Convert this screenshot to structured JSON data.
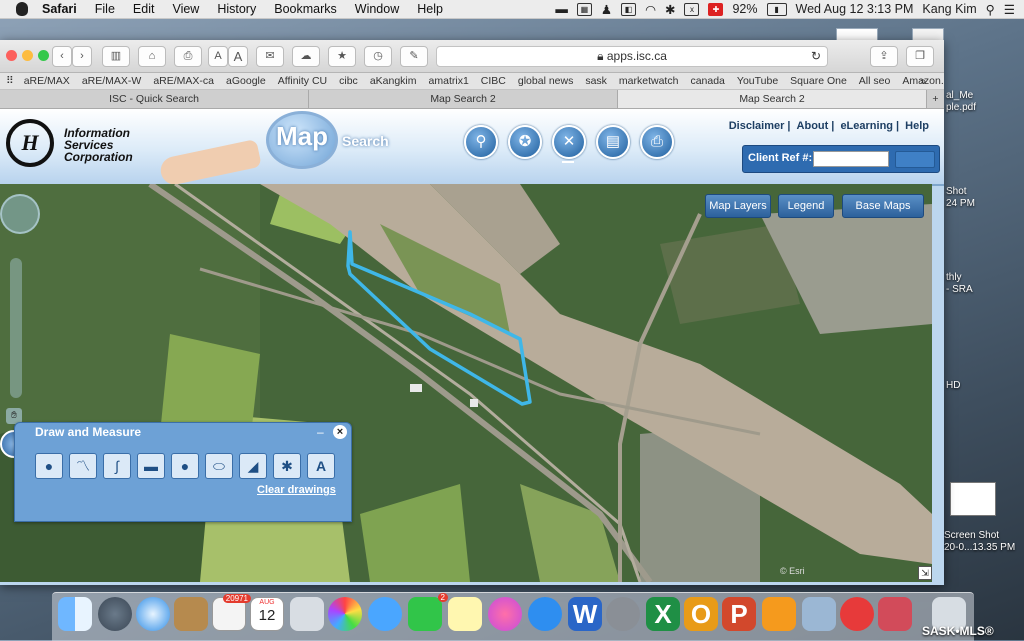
{
  "menubar": {
    "app": "Safari",
    "items": [
      "File",
      "Edit",
      "View",
      "History",
      "Bookmarks",
      "Window",
      "Help"
    ],
    "battery": "92%",
    "datetime": "Wed Aug 12  3:13 PM",
    "user": "Kang Kim"
  },
  "browser": {
    "url": "apps.isc.ca",
    "favorites": [
      "aRE/MAX",
      "aRE/MAX-W",
      "aRE/MAX-ca",
      "aGoogle",
      "Affinity CU",
      "cibc",
      "aKangkim",
      "amatrix1",
      "CIBC",
      "global news",
      "sask",
      "marketwatch",
      "canada",
      "YouTube",
      "Square One",
      "All seo",
      "Amazon.ca"
    ],
    "tabs": [
      "ISC - Quick Search",
      "Map Search 2",
      "Map Search 2"
    ],
    "text_size_small": "A",
    "text_size_large": "A"
  },
  "header": {
    "logo_lines": [
      "Information",
      "Services",
      "Corporation"
    ],
    "map_word": "Map",
    "search_word": "Search",
    "links": [
      "Disclaimer",
      "About",
      "eLearning",
      "Help"
    ],
    "client_ref_label": "Client Ref #:"
  },
  "map": {
    "buttons": [
      "Map Layers",
      "Legend",
      "Base Maps"
    ],
    "attribution": "© Esri"
  },
  "draw_panel": {
    "title": "Draw and Measure",
    "clear_label": "Clear drawings"
  },
  "desktop": {
    "items": [
      "al_Me",
      "ple.pdf",
      "Shot",
      "24 PM",
      "thly",
      "- SRA",
      "HD",
      "Screen Shot",
      "20-0...13.35 PM"
    ]
  },
  "dock": {
    "calendar_month": "AUG",
    "calendar_day": "12",
    "contacts_badge": "20971",
    "messages_badge": "2"
  },
  "watermark": "SASK•MLS®",
  "colors": {
    "accent": "#2e6bb0",
    "parcel_outline": "#3fb7e8",
    "river": "#b8ac9a"
  }
}
